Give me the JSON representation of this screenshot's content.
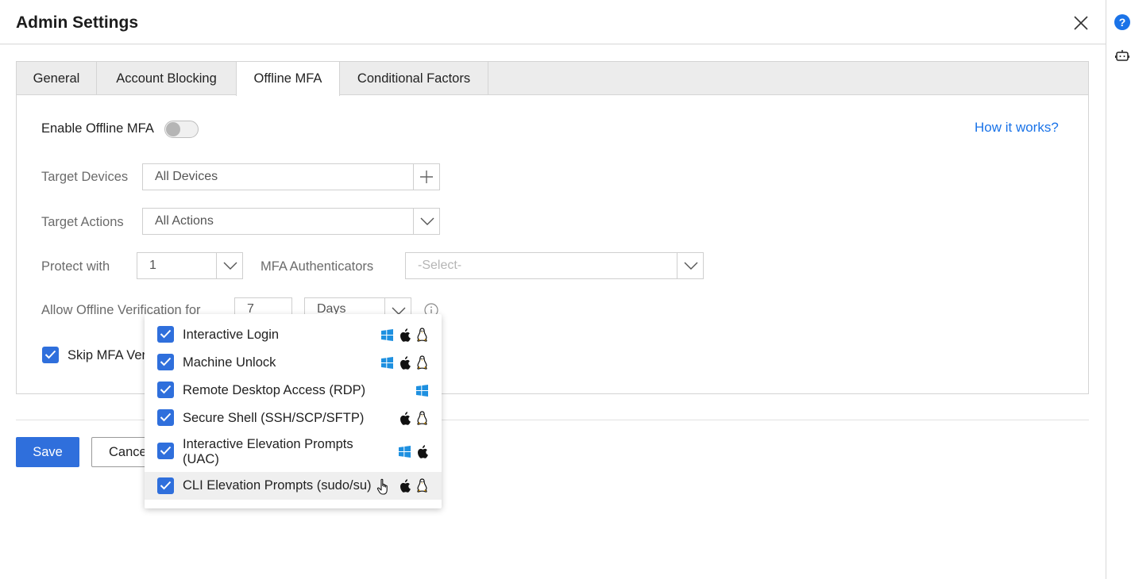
{
  "dialog": {
    "title": "Admin Settings"
  },
  "tabs": [
    {
      "label": "General",
      "active": false
    },
    {
      "label": "Account Blocking",
      "active": false
    },
    {
      "label": "Offline MFA",
      "active": true
    },
    {
      "label": "Conditional Factors",
      "active": false
    }
  ],
  "form": {
    "enable_label": "Enable Offline MFA",
    "enable_on": false,
    "how_it_works": "How it works?",
    "target_devices_label": "Target Devices",
    "target_devices_value": "All Devices",
    "target_actions_label": "Target Actions",
    "target_actions_value": "All Actions",
    "protect_with_label": "Protect with",
    "protect_with_value": "1",
    "mfa_auth_label": "MFA Authenticators",
    "mfa_auth_placeholder": "-Select-",
    "allow_offline_label": "Allow Offline Verification for",
    "allow_offline_value": "7",
    "allow_offline_unit": "Days",
    "skip_mfa_label": "Skip MFA Ver",
    "skip_mfa_checked": true
  },
  "actions_dropdown": {
    "options": [
      {
        "label": "Interactive Login",
        "checked": true,
        "os": [
          "windows-icon",
          "apple-icon",
          "linux-icon"
        ]
      },
      {
        "label": "Machine Unlock",
        "checked": true,
        "os": [
          "windows-icon",
          "apple-icon",
          "linux-icon"
        ]
      },
      {
        "label": "Remote Desktop Access (RDP)",
        "checked": true,
        "os": [
          "windows-icon"
        ]
      },
      {
        "label": "Secure Shell (SSH/SCP/SFTP)",
        "checked": true,
        "os": [
          "apple-icon",
          "linux-icon"
        ]
      },
      {
        "label": "Interactive Elevation Prompts (UAC)",
        "checked": true,
        "os": [
          "windows-icon",
          "apple-icon"
        ]
      },
      {
        "label": "CLI Elevation Prompts (sudo/su)",
        "checked": true,
        "os": [
          "apple-icon",
          "linux-icon"
        ],
        "hovered": true
      }
    ]
  },
  "footer": {
    "save_label": "Save",
    "cancel_label": "Cancel"
  },
  "colors": {
    "accent": "#2f6fdc",
    "link": "#1a73e8",
    "windows": "#1e90e0"
  }
}
